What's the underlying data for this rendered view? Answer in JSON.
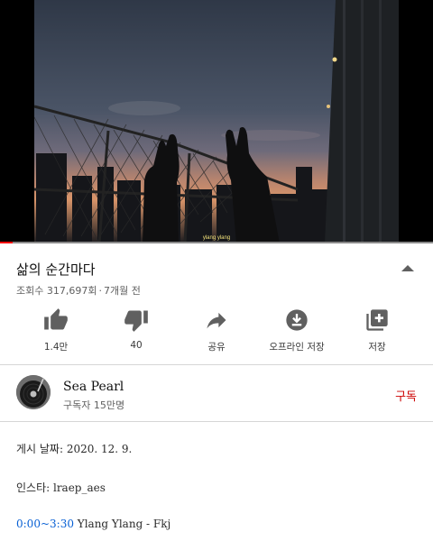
{
  "video": {
    "caption": "ylang ylang",
    "progress": 0.03
  },
  "info": {
    "title": "삶의 순간마다",
    "views": "조회수 317,697회",
    "separator": "·",
    "age": "7개월 전",
    "collapse_icon": "chevron-up-icon"
  },
  "actions": [
    {
      "label": "1.4만",
      "icon": "thumbs-up-icon"
    },
    {
      "label": "40",
      "icon": "thumbs-down-icon"
    },
    {
      "label": "공유",
      "icon": "share-icon"
    },
    {
      "label": "오프라인 저장",
      "icon": "download-icon"
    },
    {
      "label": "저장",
      "icon": "playlist-add-icon"
    }
  ],
  "channel": {
    "name": "Sea Pearl",
    "subscribers": "구독자 15만명",
    "subscribe_label": "구독",
    "subscribe_color": "#cc0000"
  },
  "description": {
    "posted": "게시 날짜: 2020. 12. 9.",
    "instagram": "인스타: lraep_aes",
    "track_start": "0:00",
    "track_tilde": "~",
    "track_end": "3:30",
    "track_title": " Ylang Ylang - Fkj"
  },
  "colors": {
    "accent_red": "#ff0000",
    "link_blue": "#065fd4"
  }
}
